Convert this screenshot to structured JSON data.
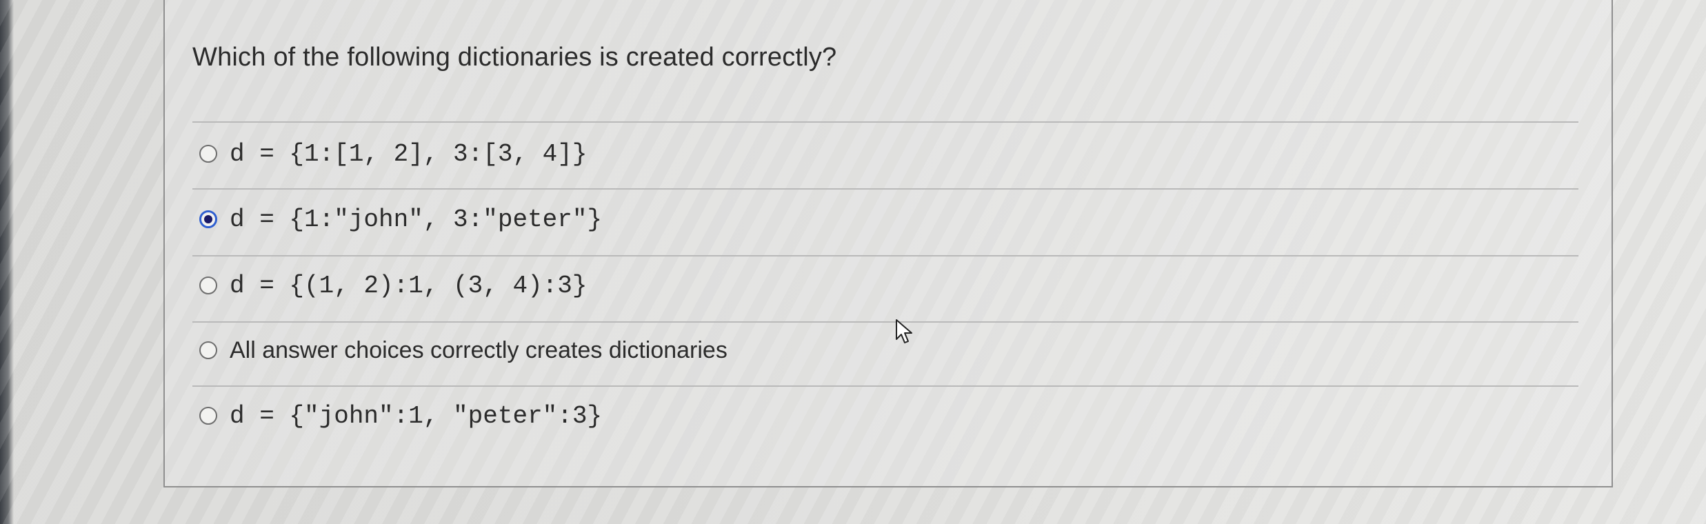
{
  "question": {
    "prompt": "Which of the following dictionaries is created correctly?"
  },
  "options": [
    {
      "text": "d = {1:[1, 2], 3:[3, 4]}",
      "selected": false,
      "font": "mono"
    },
    {
      "text": "d = {1:\"john\", 3:\"peter\"}",
      "selected": true,
      "font": "mono"
    },
    {
      "text": "d = {(1, 2):1, (3, 4):3}",
      "selected": false,
      "font": "mono"
    },
    {
      "text": "All answer choices correctly creates dictionaries",
      "selected": false,
      "font": "sans"
    },
    {
      "text": "d = {\"john\":1, \"peter\":3}",
      "selected": false,
      "font": "mono"
    }
  ],
  "colors": {
    "selected_radio": "#2f5fd0",
    "text": "#2b2b2b"
  },
  "icons": {
    "cursor": "mouse-pointer-icon"
  }
}
